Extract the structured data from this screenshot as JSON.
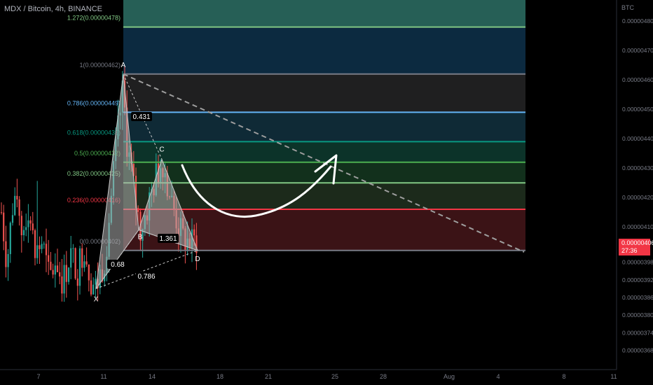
{
  "header": {
    "title": "MDX / Bitcoin, 4h, BINANCE",
    "unit": "BTC"
  },
  "colors": {
    "background": "#000000",
    "up_candle": "#26a69a",
    "down_candle": "#ef5350",
    "pattern_fill": "#b0b0b0",
    "accent_red": "#f23645"
  },
  "price_tag": {
    "price": "0.00000406",
    "countdown": "27:36"
  },
  "chart_data": {
    "type": "candlestick",
    "title": "MDX / Bitcoin, 4h, BINANCE",
    "ylabel": "BTC",
    "ylim": [
      3.665e-06,
      4.905e-06
    ],
    "y_ticks": [
      "0.00000368",
      "0.00000374",
      "0.00000380",
      "0.00000386",
      "0.00000392",
      "0.00000398",
      "0.00000410",
      "0.00000420",
      "0.00000430",
      "0.00000440",
      "0.00000450",
      "0.00000460",
      "0.00000470",
      "0.00000480"
    ],
    "x_ticks": [
      "7",
      "11",
      "14",
      "18",
      "21",
      "25",
      "28",
      "Aug",
      "4",
      "8",
      "11"
    ],
    "current_price": 4.06e-06,
    "fib_levels": [
      {
        "label": "0(0.00000402)",
        "ratio": 0,
        "price": 4.02e-06,
        "color": "#787b86"
      },
      {
        "label": "0.236(0.00000416)",
        "ratio": 0.236,
        "price": 4.16e-06,
        "color": "#f23645"
      },
      {
        "label": "0.382(0.00000425)",
        "ratio": 0.382,
        "price": 4.25e-06,
        "color": "#81c784"
      },
      {
        "label": "0.5(0.00000432)",
        "ratio": 0.5,
        "price": 4.32e-06,
        "color": "#4caf50"
      },
      {
        "label": "0.618(0.00000439)",
        "ratio": 0.618,
        "price": 4.39e-06,
        "color": "#089981"
      },
      {
        "label": "0.786(0.00000449)",
        "ratio": 0.786,
        "price": 4.49e-06,
        "color": "#64b5f6"
      },
      {
        "label": "1(0.00000462)",
        "ratio": 1,
        "price": 4.62e-06,
        "color": "#787b86"
      },
      {
        "label": "1.272(0.00000478)",
        "ratio": 1.272,
        "price": 4.78e-06,
        "color": "#81c784"
      }
    ],
    "harmonic_pattern": {
      "points": [
        {
          "name": "X",
          "price": 3.89e-06
        },
        {
          "name": "A",
          "price": 4.62e-06
        },
        {
          "name": "B",
          "price": 4.09e-06
        },
        {
          "name": "C",
          "price": 4.33e-06
        },
        {
          "name": "D",
          "price": 4.02e-06
        }
      ],
      "ratios": [
        "0.68",
        "0.431",
        "1.361",
        "0.786"
      ]
    }
  }
}
